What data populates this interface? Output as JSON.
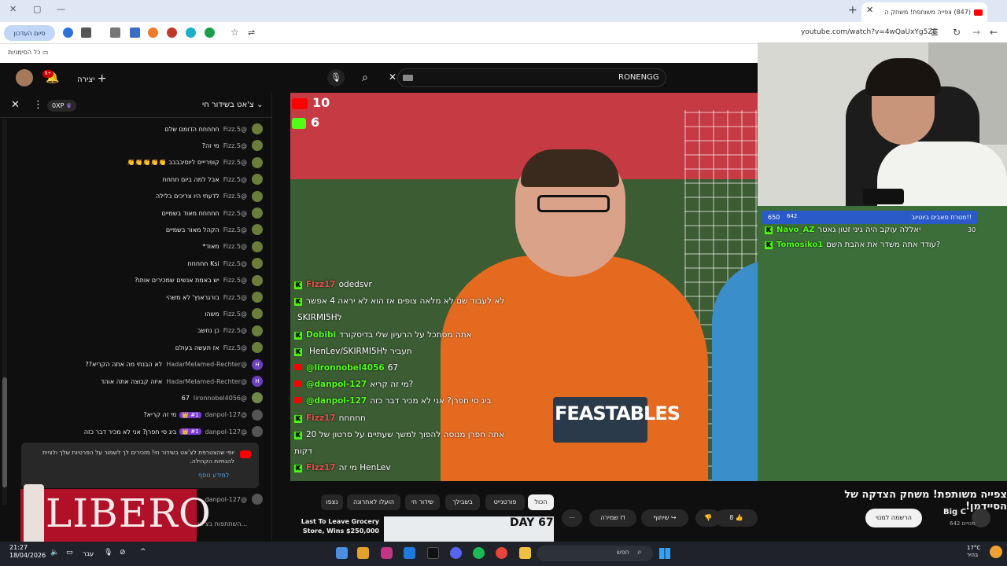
{
  "browser": {
    "tab_title": "(847) צפייה משותפת! משחק ה",
    "url": "youtube.com/watch?v=4wQaUxYg5ZE",
    "end_session": "סיום העדכון",
    "bookmarks_label": "כל הסימניות"
  },
  "youtube": {
    "search_query": "RONENGG",
    "create_label": "יצירה",
    "notif_count": "9+"
  },
  "chat": {
    "title": "צ'אט בשידור חי",
    "xp": "0XP",
    "messages": [
      {
        "author": "@Fizz.5",
        "text": "חחחחח הדומם שלם",
        "color": "#6a7d3a",
        "initial": ""
      },
      {
        "author": "@Fizz.5",
        "text": "מי זה?",
        "color": "#6a7d3a",
        "initial": ""
      },
      {
        "author": "@Fizz.5",
        "text": "קופריייס ליוסיבבבב 👏👏👏👏👏",
        "color": "#6a7d3a",
        "initial": ""
      },
      {
        "author": "@Fizz.5",
        "text": "אבל למה ביום חחחח",
        "color": "#6a7d3a",
        "initial": ""
      },
      {
        "author": "@Fizz.5",
        "text": "לדעתי היו צריכים בלילה",
        "color": "#6a7d3a",
        "initial": ""
      },
      {
        "author": "@Fizz.5",
        "text": "חחחחח מאוד בשמיים",
        "color": "#6a7d3a",
        "initial": ""
      },
      {
        "author": "@Fizz.5",
        "text": "הקהל מאור בשמיים",
        "color": "#6a7d3a",
        "initial": ""
      },
      {
        "author": "@Fizz.5",
        "text": "מאוד*",
        "color": "#6a7d3a",
        "initial": ""
      },
      {
        "author": "@Fizz.5",
        "text": "Ksi חחחחח",
        "color": "#6a7d3a",
        "initial": ""
      },
      {
        "author": "@Fizz.5",
        "text": "יש באמת אנשים שמכירים אותו?",
        "color": "#6a7d3a",
        "initial": ""
      },
      {
        "author": "@Fizz.5",
        "text": "בורגראנץ' לא משהי",
        "color": "#6a7d3a",
        "initial": ""
      },
      {
        "author": "@Fizz.5",
        "text": "משהו",
        "color": "#6a7d3a",
        "initial": ""
      },
      {
        "author": "@Fizz.5",
        "text": "כן נחשב",
        "color": "#6a7d3a",
        "initial": ""
      },
      {
        "author": "@Fizz.5",
        "text": "אז תעשה בעולם",
        "color": "#6a7d3a",
        "initial": ""
      },
      {
        "author": "@HadarMelamed-Rechter",
        "text": "לא הבנתי מה אתה הקריא??",
        "color": "#6b3fc4",
        "initial": "H"
      },
      {
        "author": "@HadarMelamed-Rechter",
        "text": "איזה קבוצה אתה אוהד",
        "color": "#6b3fc4",
        "initial": "H"
      },
      {
        "author": "@lironnobel4056",
        "text": "67",
        "color": "#6e8a4a",
        "initial": ""
      },
      {
        "author": "@danpol-127",
        "text": "מי זה קריא?",
        "color": "#555",
        "initial": "",
        "badge": "#1 👑"
      },
      {
        "author": "@danpol-127",
        "text": "ביג סי חפרן? אני לא מכיר דבר כזה",
        "color": "#555",
        "initial": "",
        "badge": "#1 👑"
      }
    ],
    "notice_text": "יופי שהצטרפת לצ'אט בשידור חי! מזכירים לך לשמור על הפרטיות שלך ולציית להנחיות הקהילה.",
    "learn_more": "למידע נוסף",
    "last_author": "@danpol-127",
    "input_placeholder": "השתתפות בצ'אט..."
  },
  "ad": {
    "brand": "LIBERO"
  },
  "video_overlay": {
    "score_youtube": "10",
    "score_kick": "6",
    "lines": [
      {
        "platform": "kick",
        "name": "Fizz17",
        "text": "odedsvr"
      },
      {
        "platform": "kick",
        "name": "",
        "text": "לא לעבוד שם לא מלאה צופים אז הוא לא יראה 4 אפשר"
      },
      {
        "platform": "none",
        "name": "",
        "text": "SKIRMI5Hל"
      },
      {
        "platform": "kick",
        "name": "Dobibi",
        "text": "אתה מסתכל על הרעיון שלי בדיסקורד"
      },
      {
        "platform": "kick",
        "name": "",
        "text": "HenLev/SKIRMI5Hתעביר ל"
      },
      {
        "platform": "youtube",
        "name": "@lironnobel4056",
        "text": "67"
      },
      {
        "platform": "youtube",
        "name": "@danpol-127",
        "text": "מי זה קריא?"
      },
      {
        "platform": "youtube",
        "name": "@danpol-127",
        "text": "ביג סי חפרן? אני לא מכיר דבר כזה"
      },
      {
        "platform": "kick",
        "name": "Fizz17",
        "text": "חחחחח"
      },
      {
        "platform": "kick",
        "name": "",
        "text": "אתה חפרן מנוסה להפוך למשך שעתיים על סרטון של 20"
      },
      {
        "platform": "none",
        "name": "",
        "text": "דקות"
      },
      {
        "platform": "kick",
        "name": "Fizz17",
        "text": "מי זה HenLev"
      }
    ]
  },
  "right_overlay": {
    "donation_text": "!!מטרת סאבים ביוטיוב",
    "donation_value": "650",
    "donation_left": "642",
    "lines": [
      {
        "name": "Navo_AZ",
        "text": "יאללה עוקב היה גיני זטון גאטר",
        "count": "30"
      },
      {
        "name": "Tomosiko1",
        "text": "עודד אתה משדר את אהבת השם?",
        "count": ""
      }
    ]
  },
  "below_video": {
    "title": "צפייה משותפת! משחק הצדקה של הסיידמן!",
    "channel": "Big C",
    "subscribers": "642 מנויים",
    "subscribe": "הרשמה למנוי",
    "likes": "8",
    "share": "שיתוף",
    "save": "שמירה",
    "more": "⋯",
    "chips": [
      "הכול",
      "פורטנייט",
      "בשבילך",
      "שידור חי",
      "הועלו לאחרונה",
      "נצפו"
    ],
    "rec_title": "Last To Leave Grocery Store, Wins $250,000",
    "rec_badge": "DAY 67"
  },
  "taskbar": {
    "time": "21:27",
    "date": "18/04/2026",
    "lang": "עבר",
    "search": "חפש",
    "weather_temp": "17°C",
    "weather_desc": "בהיר"
  }
}
